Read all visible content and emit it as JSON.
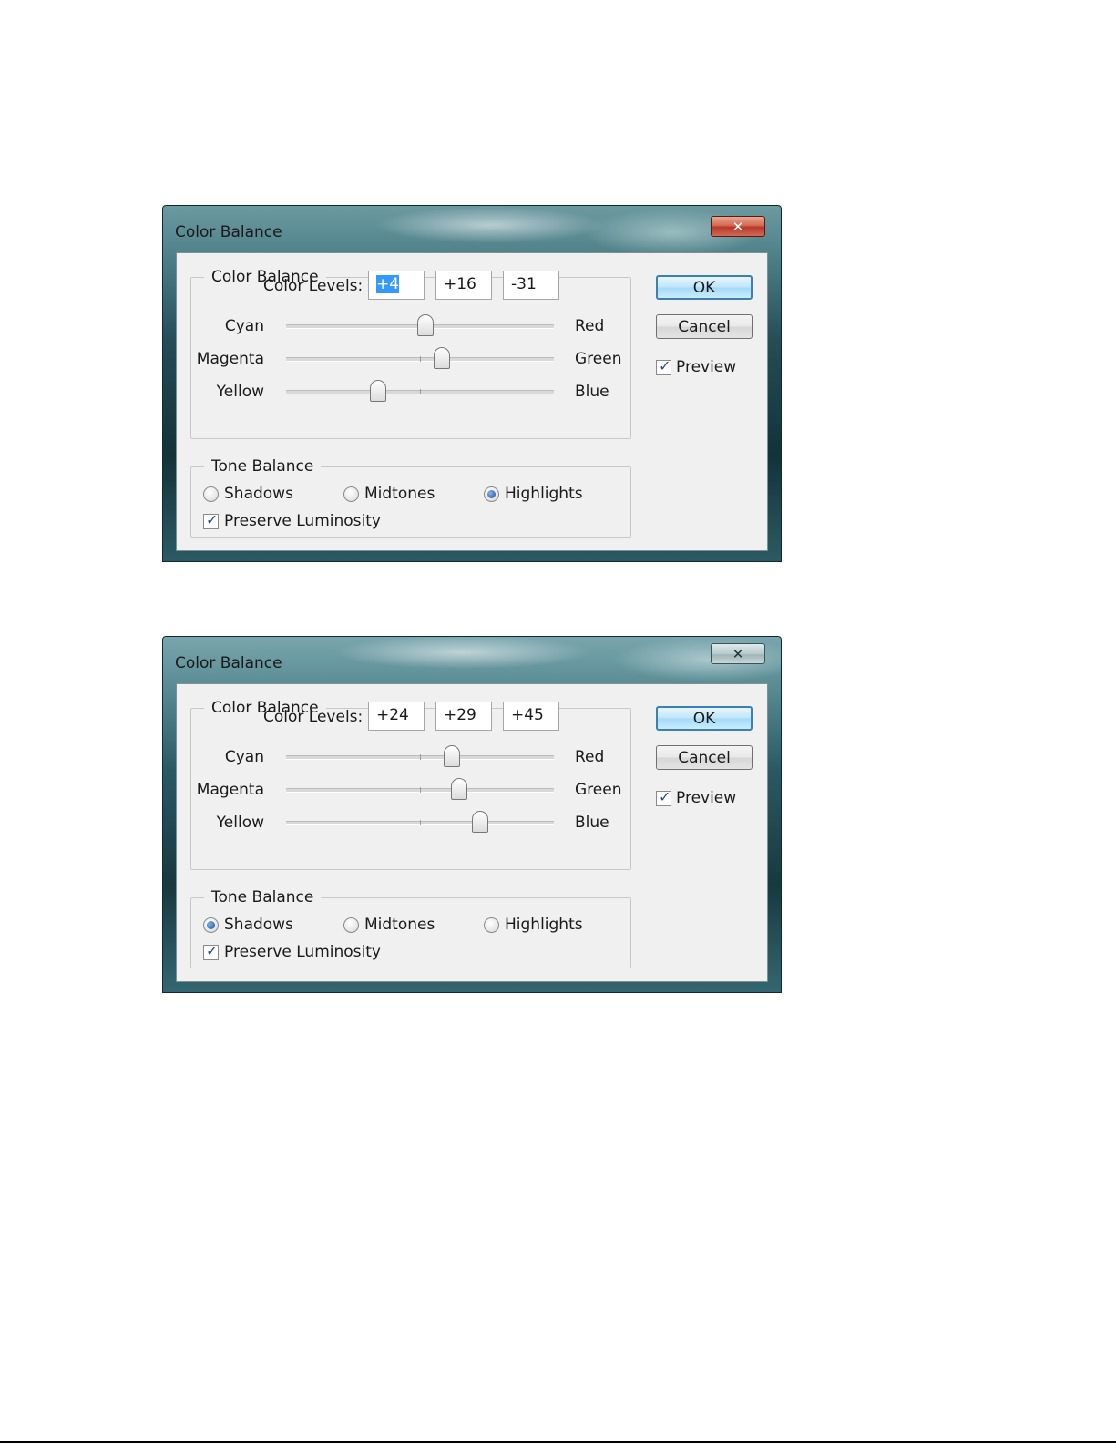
{
  "dialogs": [
    {
      "title": "Color Balance",
      "close_glyph": "✕",
      "color_balance": {
        "legend": "Color Balance",
        "levels_label": "Color Levels:",
        "levels": [
          "+4",
          "+16",
          "-31"
        ],
        "sliders": [
          {
            "left": "Cyan",
            "right": "Red",
            "value": 4
          },
          {
            "left": "Magenta",
            "right": "Green",
            "value": 16
          },
          {
            "left": "Yellow",
            "right": "Blue",
            "value": -31
          }
        ]
      },
      "tone_balance": {
        "legend": "Tone Balance",
        "options": [
          "Shadows",
          "Midtones",
          "Highlights"
        ],
        "selected": "Highlights",
        "preserve_luminosity": {
          "label": "Preserve Luminosity",
          "checked": true
        }
      },
      "buttons": {
        "ok": "OK",
        "cancel": "Cancel"
      },
      "preview": {
        "label": "Preview",
        "checked": true
      },
      "check_glyph": "✓",
      "close_icon": "close-icon"
    },
    {
      "title": "Color Balance",
      "close_glyph": "✕",
      "color_balance": {
        "legend": "Color Balance",
        "levels_label": "Color Levels:",
        "levels": [
          "+24",
          "+29",
          "+45"
        ],
        "sliders": [
          {
            "left": "Cyan",
            "right": "Red",
            "value": 24
          },
          {
            "left": "Magenta",
            "right": "Green",
            "value": 29
          },
          {
            "left": "Yellow",
            "right": "Blue",
            "value": 45
          }
        ]
      },
      "tone_balance": {
        "legend": "Tone Balance",
        "options": [
          "Shadows",
          "Midtones",
          "Highlights"
        ],
        "selected": "Shadows",
        "preserve_luminosity": {
          "label": "Preserve Luminosity",
          "checked": true
        }
      },
      "buttons": {
        "ok": "OK",
        "cancel": "Cancel"
      },
      "preview": {
        "label": "Preview",
        "checked": true
      },
      "check_glyph": "✓",
      "close_icon": "close-icon"
    }
  ],
  "slider_range": [
    -100,
    100
  ]
}
